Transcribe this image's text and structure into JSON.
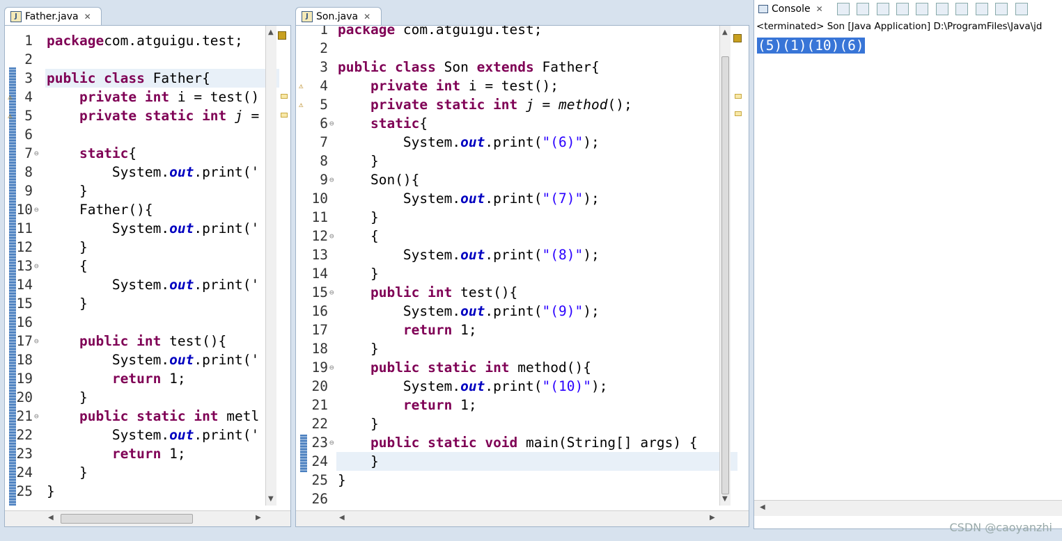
{
  "father_tab": {
    "label": "Father.java"
  },
  "son_tab": {
    "label": "Son.java"
  },
  "console_tab": {
    "label": "Console"
  },
  "console_status": "<terminated> Son [Java Application] D:\\ProgramFiles\\Java\\jd",
  "console_output": "(5)(1)(10)(6)",
  "watermark": "CSDN @caoyanzhi",
  "father_lines": [
    {
      "n": "1",
      "segs": [
        [
          "kw",
          "package"
        ],
        [
          "",
          "com.atguigu.test;"
        ]
      ]
    },
    {
      "n": "2",
      "segs": []
    },
    {
      "n": "3",
      "segs": [
        [
          "kw",
          "public class"
        ],
        [
          "",
          " Father{"
        ]
      ]
    },
    {
      "n": "4",
      "segs": [
        [
          "",
          "    "
        ],
        [
          "kw",
          "private int"
        ],
        [
          "",
          " i = test()"
        ]
      ]
    },
    {
      "n": "5",
      "segs": [
        [
          "",
          "    "
        ],
        [
          "kw",
          "private static int"
        ],
        [
          "",
          " "
        ],
        [
          "ital",
          "j"
        ],
        [
          "",
          " ="
        ]
      ]
    },
    {
      "n": "6",
      "segs": []
    },
    {
      "n": "7",
      "segs": [
        [
          "",
          "    "
        ],
        [
          "kw",
          "static"
        ],
        [
          "",
          "{"
        ]
      ]
    },
    {
      "n": "8",
      "segs": [
        [
          "",
          "        System."
        ],
        [
          "fld",
          "out"
        ],
        [
          "",
          ".print('"
        ]
      ]
    },
    {
      "n": "9",
      "segs": [
        [
          "",
          "    }"
        ]
      ]
    },
    {
      "n": "10",
      "segs": [
        [
          "",
          "    Father(){"
        ]
      ]
    },
    {
      "n": "11",
      "segs": [
        [
          "",
          "        System."
        ],
        [
          "fld",
          "out"
        ],
        [
          "",
          ".print('"
        ]
      ]
    },
    {
      "n": "12",
      "segs": [
        [
          "",
          "    }"
        ]
      ]
    },
    {
      "n": "13",
      "segs": [
        [
          "",
          "    {"
        ]
      ]
    },
    {
      "n": "14",
      "segs": [
        [
          "",
          "        System."
        ],
        [
          "fld",
          "out"
        ],
        [
          "",
          ".print('"
        ]
      ]
    },
    {
      "n": "15",
      "segs": [
        [
          "",
          "    }"
        ]
      ]
    },
    {
      "n": "16",
      "segs": []
    },
    {
      "n": "17",
      "segs": [
        [
          "",
          "    "
        ],
        [
          "kw",
          "public int"
        ],
        [
          "",
          " test(){"
        ]
      ]
    },
    {
      "n": "18",
      "segs": [
        [
          "",
          "        System."
        ],
        [
          "fld",
          "out"
        ],
        [
          "",
          ".print('"
        ]
      ]
    },
    {
      "n": "19",
      "segs": [
        [
          "",
          "        "
        ],
        [
          "kw",
          "return"
        ],
        [
          "",
          " 1;"
        ]
      ]
    },
    {
      "n": "20",
      "segs": [
        [
          "",
          "    }"
        ]
      ]
    },
    {
      "n": "21",
      "segs": [
        [
          "",
          "    "
        ],
        [
          "kw",
          "public static int"
        ],
        [
          "",
          " metl"
        ]
      ]
    },
    {
      "n": "22",
      "segs": [
        [
          "",
          "        System."
        ],
        [
          "fld",
          "out"
        ],
        [
          "",
          ".print('"
        ]
      ]
    },
    {
      "n": "23",
      "segs": [
        [
          "",
          "        "
        ],
        [
          "kw",
          "return"
        ],
        [
          "",
          " 1;"
        ]
      ]
    },
    {
      "n": "24",
      "segs": [
        [
          "",
          "    }"
        ]
      ]
    },
    {
      "n": "25",
      "segs": [
        [
          "",
          "}"
        ]
      ]
    }
  ],
  "son_lines": [
    {
      "n": "1",
      "segs": [
        [
          "kw",
          "package"
        ],
        [
          "",
          " com.atguigu.test;"
        ]
      ]
    },
    {
      "n": "2",
      "segs": []
    },
    {
      "n": "3",
      "segs": [
        [
          "kw",
          "public class"
        ],
        [
          "",
          " Son "
        ],
        [
          "kw",
          "extends"
        ],
        [
          "",
          " Father{"
        ]
      ]
    },
    {
      "n": "4",
      "segs": [
        [
          "",
          "    "
        ],
        [
          "kw",
          "private int"
        ],
        [
          "",
          " i = test();"
        ]
      ]
    },
    {
      "n": "5",
      "segs": [
        [
          "",
          "    "
        ],
        [
          "kw",
          "private static int"
        ],
        [
          "",
          " "
        ],
        [
          "ital",
          "j"
        ],
        [
          "",
          " = "
        ],
        [
          "ital",
          "method"
        ],
        [
          "",
          "();"
        ]
      ]
    },
    {
      "n": "6",
      "segs": [
        [
          "",
          "    "
        ],
        [
          "kw",
          "static"
        ],
        [
          "",
          "{"
        ]
      ]
    },
    {
      "n": "7",
      "segs": [
        [
          "",
          "        System."
        ],
        [
          "fld",
          "out"
        ],
        [
          "",
          ".print("
        ],
        [
          "str",
          "\"(6)\""
        ],
        [
          "",
          ");"
        ]
      ]
    },
    {
      "n": "8",
      "segs": [
        [
          "",
          "    }"
        ]
      ]
    },
    {
      "n": "9",
      "segs": [
        [
          "",
          "    Son(){"
        ]
      ]
    },
    {
      "n": "10",
      "segs": [
        [
          "",
          "        System."
        ],
        [
          "fld",
          "out"
        ],
        [
          "",
          ".print("
        ],
        [
          "str",
          "\"(7)\""
        ],
        [
          "",
          ");"
        ]
      ]
    },
    {
      "n": "11",
      "segs": [
        [
          "",
          "    }"
        ]
      ]
    },
    {
      "n": "12",
      "segs": [
        [
          "",
          "    {"
        ]
      ]
    },
    {
      "n": "13",
      "segs": [
        [
          "",
          "        System."
        ],
        [
          "fld",
          "out"
        ],
        [
          "",
          ".print("
        ],
        [
          "str",
          "\"(8)\""
        ],
        [
          "",
          ");"
        ]
      ]
    },
    {
      "n": "14",
      "segs": [
        [
          "",
          "    }"
        ]
      ]
    },
    {
      "n": "15",
      "segs": [
        [
          "",
          "    "
        ],
        [
          "kw",
          "public int"
        ],
        [
          "",
          " test(){"
        ]
      ]
    },
    {
      "n": "16",
      "segs": [
        [
          "",
          "        System."
        ],
        [
          "fld",
          "out"
        ],
        [
          "",
          ".print("
        ],
        [
          "str",
          "\"(9)\""
        ],
        [
          "",
          ");"
        ]
      ]
    },
    {
      "n": "17",
      "segs": [
        [
          "",
          "        "
        ],
        [
          "kw",
          "return"
        ],
        [
          "",
          " 1;"
        ]
      ]
    },
    {
      "n": "18",
      "segs": [
        [
          "",
          "    }"
        ]
      ]
    },
    {
      "n": "19",
      "segs": [
        [
          "",
          "    "
        ],
        [
          "kw",
          "public static int"
        ],
        [
          "",
          " method(){"
        ]
      ]
    },
    {
      "n": "20",
      "segs": [
        [
          "",
          "        System."
        ],
        [
          "fld",
          "out"
        ],
        [
          "",
          ".print("
        ],
        [
          "str",
          "\"(10)\""
        ],
        [
          "",
          ");"
        ]
      ]
    },
    {
      "n": "21",
      "segs": [
        [
          "",
          "        "
        ],
        [
          "kw",
          "return"
        ],
        [
          "",
          " 1;"
        ]
      ]
    },
    {
      "n": "22",
      "segs": [
        [
          "",
          "    }"
        ]
      ]
    },
    {
      "n": "23",
      "segs": [
        [
          "",
          "    "
        ],
        [
          "kw",
          "public static void"
        ],
        [
          "",
          " main(String[] args) {"
        ]
      ]
    },
    {
      "n": "24",
      "segs": [
        [
          "",
          "    }"
        ]
      ]
    },
    {
      "n": "25",
      "segs": [
        [
          "",
          "}"
        ]
      ]
    },
    {
      "n": "26",
      "segs": []
    }
  ]
}
